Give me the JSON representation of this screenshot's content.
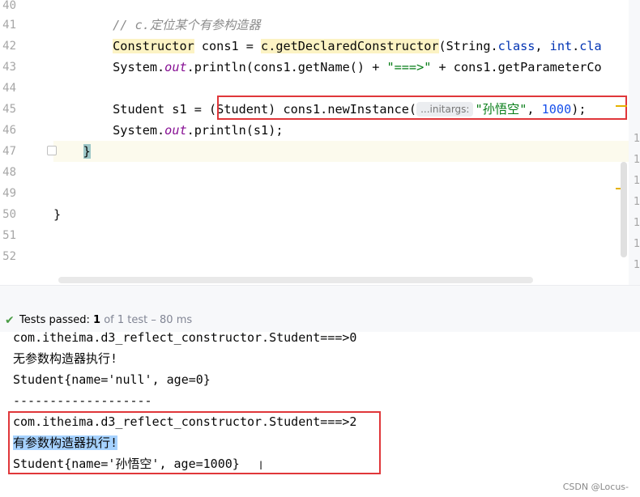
{
  "editor": {
    "line_numbers": [
      "40",
      "41",
      "42",
      "43",
      "44",
      "45",
      "46",
      "47",
      "48",
      "49",
      "50",
      "51",
      "52"
    ],
    "comment": "// c.定位某个有参构造器",
    "line42": {
      "type": "Constructor",
      "decl": " cons1 = ",
      "call": "c.getDeclaredConstructor",
      "args_open": "(String.",
      "class1": "class",
      "sep": ", ",
      "int": "int",
      "dot": ".",
      "class2": "cla"
    },
    "line43": {
      "pre": "System.",
      "out": "out",
      "mid": ".println(cons1.getName() + ",
      "str": "\"===>\"",
      "post": " + cons1.getParameterCo"
    },
    "line45": {
      "pre": "Student s1 = ",
      "cast": "(Student) cons1.newInstance(",
      "hint": "...initargs:",
      "str": "\"孙悟空\"",
      "comma": ", ",
      "num": "1000",
      "end": ");"
    },
    "line46": {
      "pre": "System.",
      "out": "out",
      "post": ".println(s1);"
    },
    "line47": "}",
    "line50": "}",
    "right_marks": [
      "1",
      "1",
      "1",
      "1",
      "1",
      "1",
      "1"
    ]
  },
  "test_bar": {
    "passed_label": "Tests passed: ",
    "passed_count": "1",
    "of_text": " of 1 test – 80 ms"
  },
  "console": {
    "lines": [
      "com.itheima.d3_reflect_constructor.Student===>0",
      "无参数构造器执行!",
      "Student{name='null', age=0}",
      "-------------------",
      "com.itheima.d3_reflect_constructor.Student===>2",
      "有参数构造器执行!",
      "Student{name='孙悟空', age=1000}"
    ]
  },
  "watermark": "CSDN @Locus-",
  "colors": {
    "keyword": "#0033b3",
    "string": "#067d17",
    "number": "#1750eb",
    "highlight_box": "#e0373a",
    "selection": "#a6d2ff",
    "check": "#4a9c45"
  }
}
